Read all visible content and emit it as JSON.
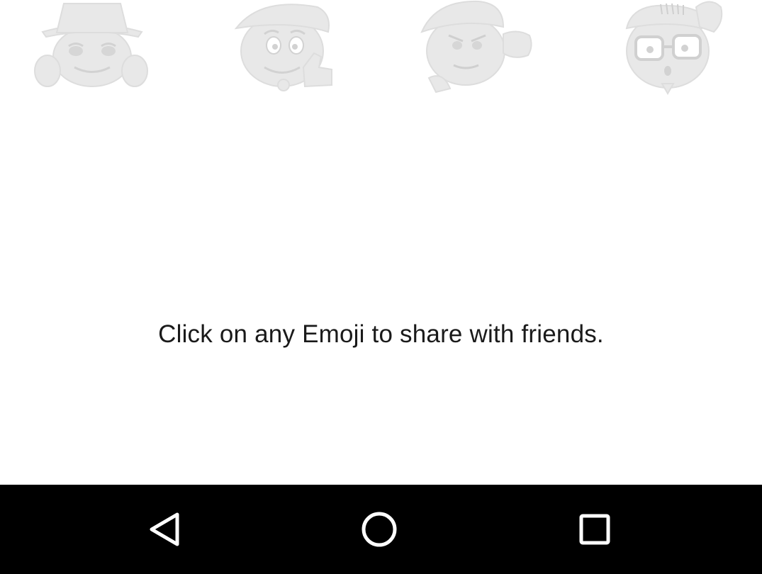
{
  "emojis": [
    {
      "icon": "hat-sunglasses-emoji-icon"
    },
    {
      "icon": "cap-thumbs-up-emoji-icon"
    },
    {
      "icon": "cap-fist-emoji-icon"
    },
    {
      "icon": "glasses-comb-emoji-icon"
    }
  ],
  "main": {
    "hint_text": "Click on any Emoji to share with friends."
  },
  "navigation_bar": {
    "back_icon": "back-triangle-icon",
    "home_icon": "home-circle-icon",
    "recents_icon": "recents-square-icon",
    "background": "#000000",
    "icon_color": "#ffffff"
  },
  "colors": {
    "emoji_tint": "#e6e6e6",
    "text": "#1a1a1a",
    "background": "#ffffff"
  }
}
